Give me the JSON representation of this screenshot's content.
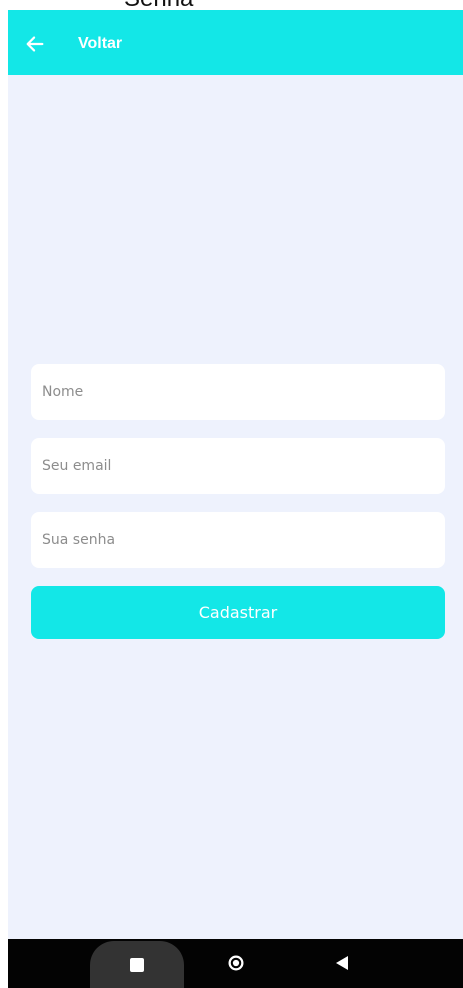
{
  "page": {
    "cropped_title": "Senha"
  },
  "app_bar": {
    "back_label": "Voltar",
    "back_icon": "arrow-left-icon"
  },
  "form": {
    "fields": [
      {
        "name": "name-input",
        "placeholder": "Nome",
        "value": ""
      },
      {
        "name": "email-input",
        "placeholder": "Seu email",
        "value": ""
      },
      {
        "name": "password-input",
        "placeholder": "Sua senha",
        "value": ""
      }
    ],
    "submit_label": "Cadastrar"
  },
  "system_navigation": {
    "buttons": [
      "square-icon",
      "circle-icon",
      "back-triangle-icon"
    ]
  },
  "colors": {
    "accent": "#13e7e7",
    "background": "#eef2fd",
    "field_background": "#ffffff",
    "navbar": "#030303",
    "nav_highlight": "#333333",
    "text_light": "#ffffff",
    "placeholder": "#8d8d8d"
  }
}
